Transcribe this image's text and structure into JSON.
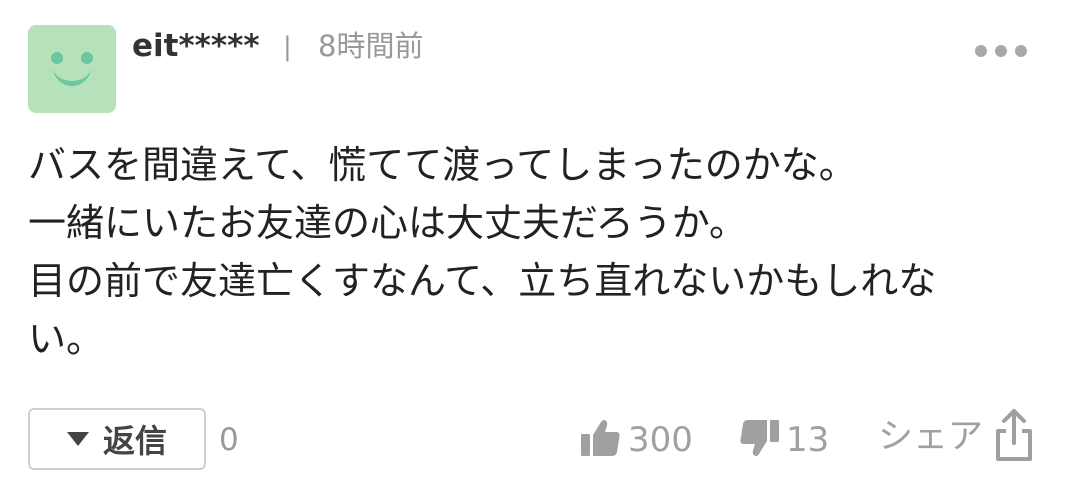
{
  "comment": {
    "username": "eit*****",
    "separator": "|",
    "timestamp": "8時間前",
    "lines": [
      "バスを間違えて、慌てて渡ってしまったのかな。",
      "一緒にいたお友達の心は大丈夫だろうか。",
      "目の前で友達亡くすなんて、立ち直れないかもしれな",
      "い。"
    ]
  },
  "actions": {
    "reply_label": "返信",
    "reply_count": "0",
    "like_count": "300",
    "dislike_count": "13",
    "share_label": "シェア"
  },
  "icons": {
    "avatar": "smiley-avatar-icon",
    "more": "more-dots-icon",
    "reply_toggle": "triangle-down-icon",
    "like": "thumbs-up-icon",
    "dislike": "thumbs-down-icon",
    "share": "share-icon"
  },
  "colors": {
    "avatar_bg": "#b5e2b8",
    "avatar_face": "#6bc6a2",
    "muted_text": "#999999",
    "body_text": "#222222"
  }
}
